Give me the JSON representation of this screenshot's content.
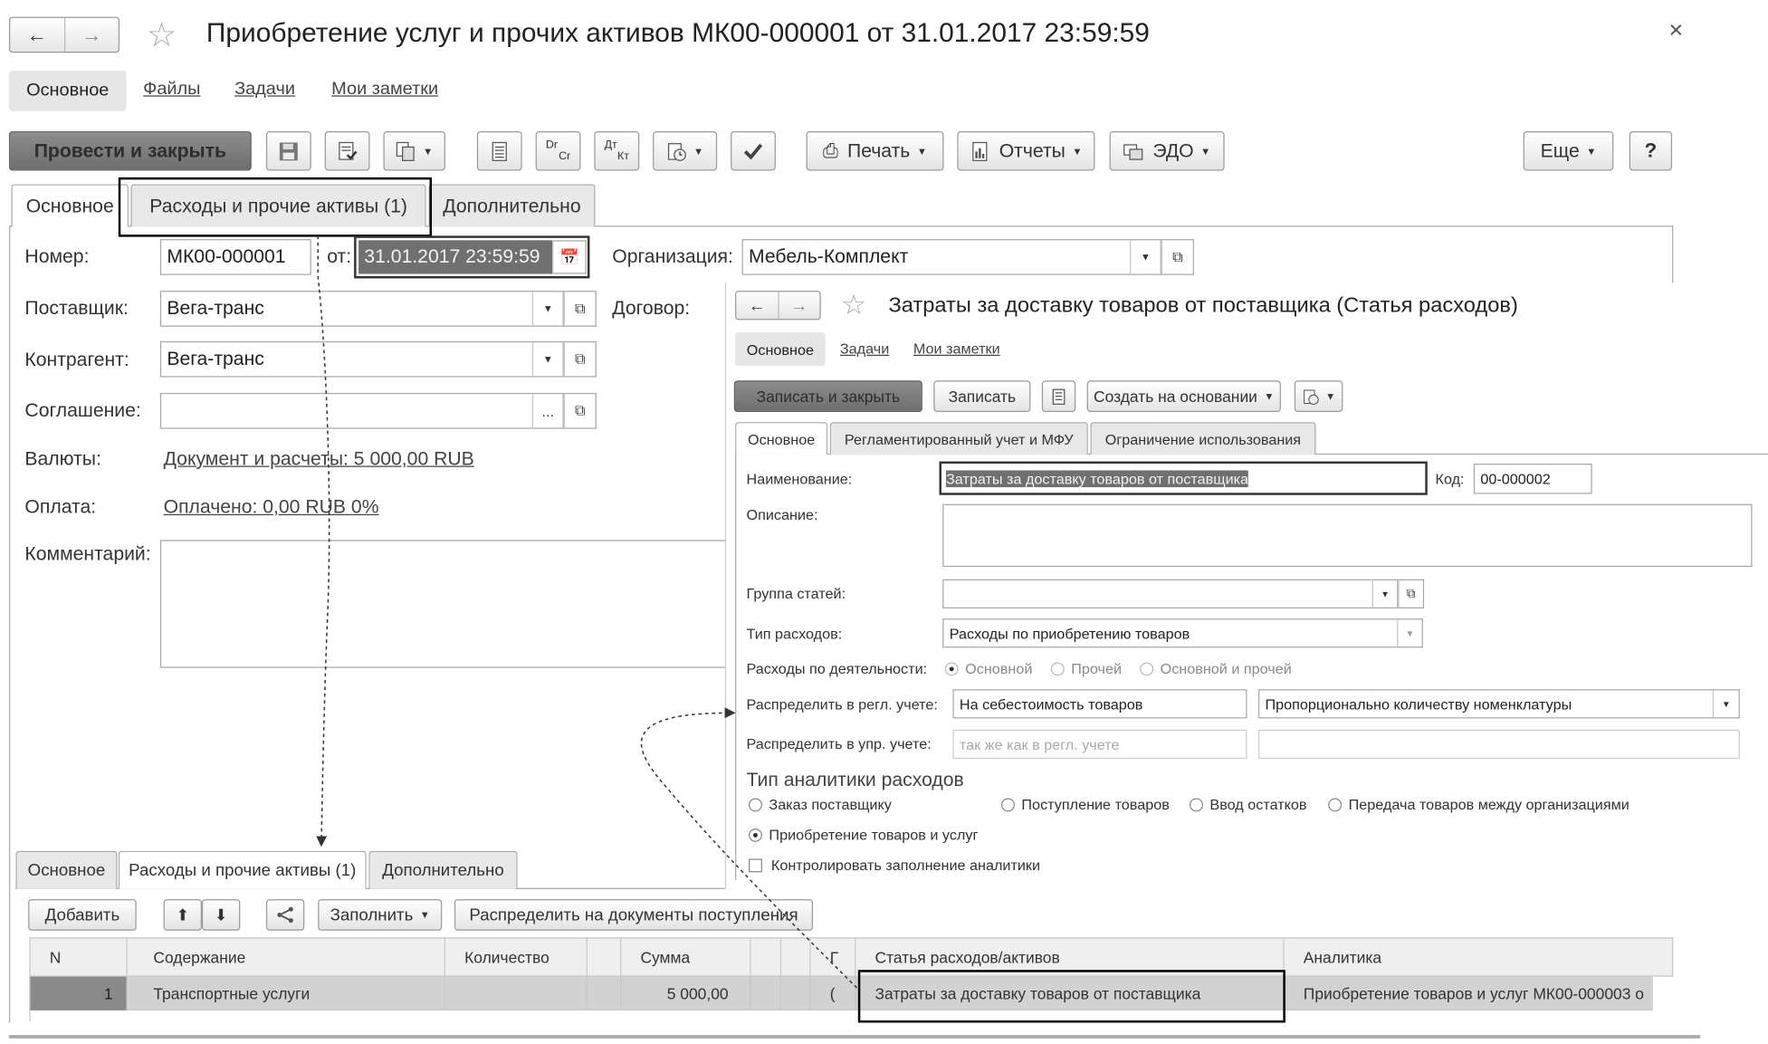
{
  "main": {
    "title": "Приобретение услуг и прочих активов МК00-000001 от 31.01.2017 23:59:59",
    "close_glyph": "×",
    "nav_tabs": [
      "Основное",
      "Файлы",
      "Задачи",
      "Мои заметки"
    ],
    "toolbar": {
      "post_close": "Провести и закрыть",
      "dr_cr": {
        "top": "Dr",
        "bottom": "Cr"
      },
      "dt_kt": {
        "top": "Дт",
        "bottom": "Кт"
      },
      "print": "Печать",
      "reports": "Отчеты",
      "edo": "ЭДО",
      "more": "Еще",
      "help": "?"
    },
    "form_tabs": [
      "Основное",
      "Расходы и прочие активы (1)",
      "Дополнительно"
    ],
    "fields": {
      "number_label": "Номер:",
      "number_value": "МК00-000001",
      "from_label": "от:",
      "date_value": "31.01.2017 23:59:59",
      "org_label": "Организация:",
      "org_value": "Мебель-Комплект",
      "supplier_label": "Поставщик:",
      "supplier_value": "Вега-транс",
      "contract_label": "Договор:",
      "counterparty_label": "Контрагент:",
      "counterparty_value": "Вега-транс",
      "agreement_label": "Соглашение:",
      "agreement_value": "",
      "ellipsis": "...",
      "currency_label": "Валюты:",
      "currency_link": "Документ и расчеты: 5 000,00 RUB",
      "payment_label": "Оплата:",
      "payment_link": "Оплачено: 0,00 RUB  0%",
      "comment_label": "Комментарий:"
    }
  },
  "sub": {
    "title": "Затраты за доставку товаров от поставщика (Статья расходов)",
    "nav_tabs": [
      "Основное",
      "Задачи",
      "Мои заметки"
    ],
    "toolbar": {
      "save_close": "Записать и закрыть",
      "save": "Записать",
      "create_based": "Создать на основании"
    },
    "form_tabs": [
      "Основное",
      "Регламентированный учет и МФУ",
      "Ограничение использования"
    ],
    "name_label": "Наименование:",
    "name_value": "Затраты за доставку товаров от поставщика",
    "code_label": "Код:",
    "code_value": "00-000002",
    "desc_label": "Описание:",
    "group_label": "Группа статей:",
    "group_value": "",
    "type_label": "Тип расходов:",
    "type_value": "Расходы по приобретению товаров",
    "activity_label": "Расходы по деятельности:",
    "activity_options": [
      "Основной",
      "Прочей",
      "Основной и прочей"
    ],
    "reg_label": "Распределить в регл. учете:",
    "reg_value": "На себестоимость товаров",
    "reg_method": "Пропорционально количеству номенклатуры",
    "mgmt_label": "Распределить в упр. учете:",
    "mgmt_placeholder": "так же как в регл. учете",
    "analytics_heading": "Тип аналитики расходов",
    "analytics_options": [
      "Заказ поставщику",
      "Поступление товаров",
      "Ввод остатков",
      "Передача товаров между организациями",
      "Приобретение товаров и услуг"
    ],
    "control_label": "Контролировать заполнение аналитики"
  },
  "bottom": {
    "tabs": [
      "Основное",
      "Расходы и прочие активы (1)",
      "Дополнительно"
    ],
    "toolbar": {
      "add": "Добавить",
      "fill": "Заполнить",
      "distribute": "Распределить на документы поступления"
    },
    "grid": {
      "headers": [
        "N",
        "Содержание",
        "Количество",
        "Сумма",
        "Г",
        "Статья расходов/активов",
        "Аналитика"
      ],
      "rows": [
        {
          "n": "1",
          "content": "Транспортные услуги",
          "qty": "",
          "sum": "5 000,00",
          "g": "(",
          "article": "Затраты за доставку товаров от поставщика",
          "analytics": "Приобретение товаров и услуг МК00-000003 о"
        }
      ]
    }
  },
  "colors": {
    "accent_dark": "#7a7a7a",
    "selection": "#707070",
    "highlight_box": "#000000"
  }
}
